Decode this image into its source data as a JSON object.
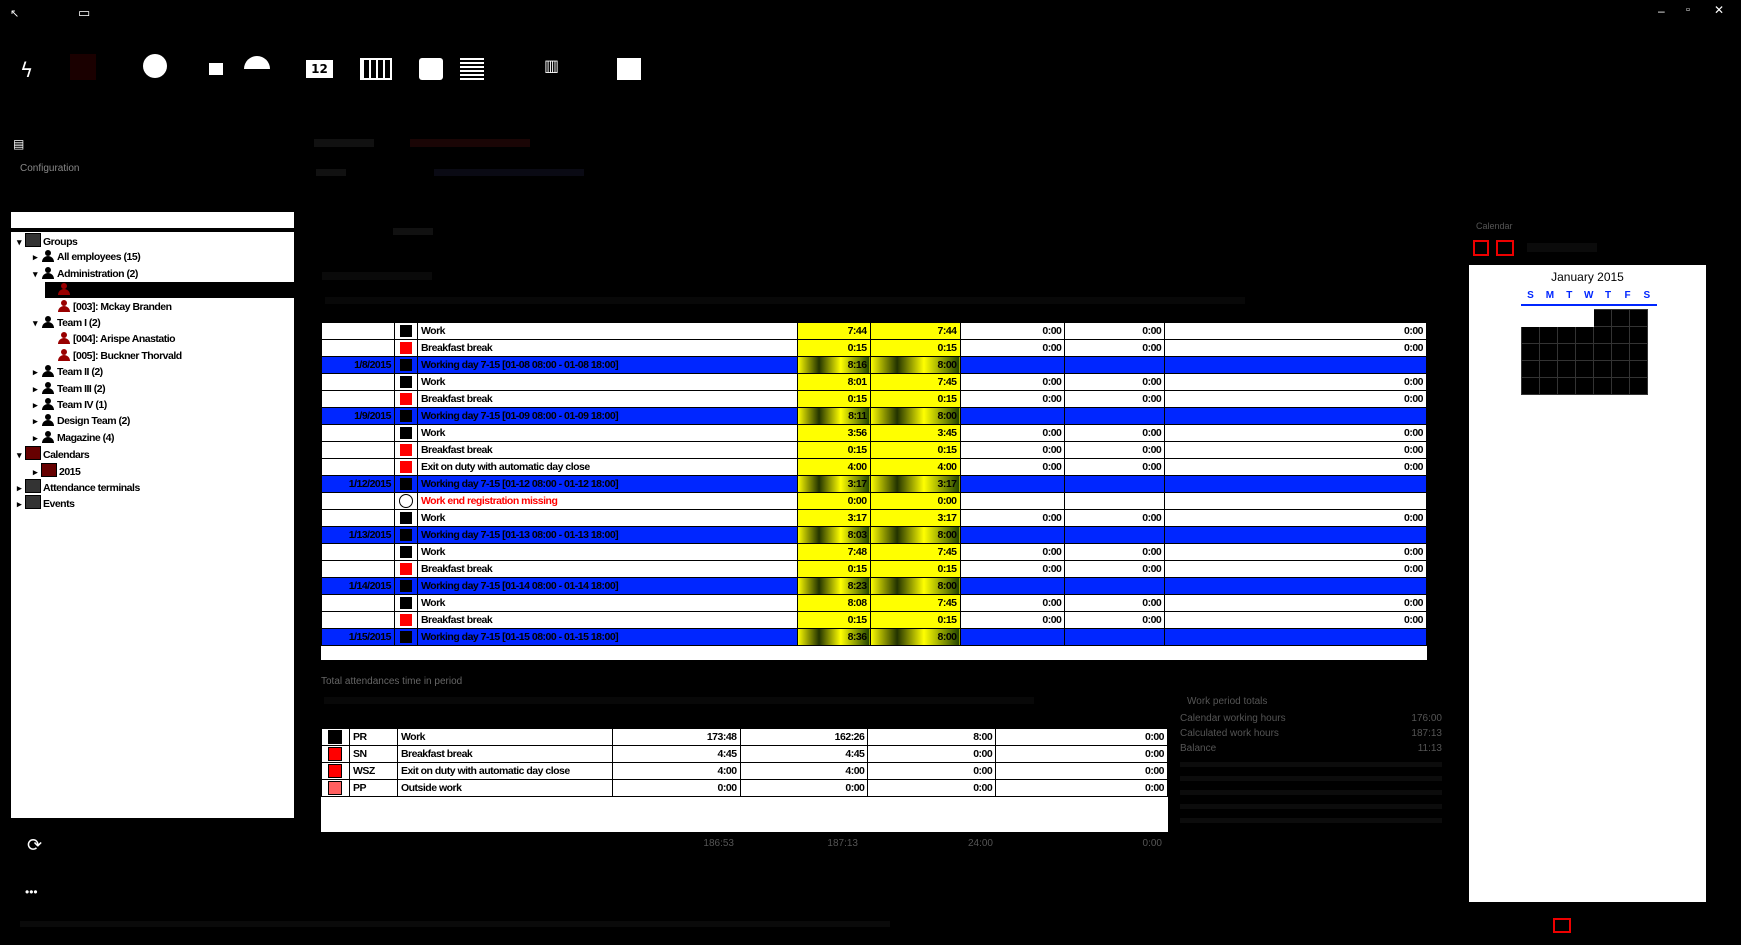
{
  "toolbar": {
    "icons": [
      "flash-icon",
      "clock-icon",
      "calendar-day-icon",
      "gauge-icon",
      "calendar-12-icon",
      "grid-icon",
      "gear-icon",
      "list-icon",
      "building-icon",
      "sliders-icon"
    ]
  },
  "left": {
    "config_label": "Configuration"
  },
  "tree": {
    "items": [
      {
        "arrow": "▾",
        "label": "Groups",
        "indent": 0,
        "icon": "group"
      },
      {
        "arrow": "▸",
        "label": "All employees (15)",
        "indent": 1,
        "icon": "person"
      },
      {
        "arrow": "▾",
        "label": "Administration (2)",
        "indent": 1,
        "icon": "person"
      },
      {
        "arrow": "",
        "label": "",
        "indent": 2,
        "icon": "person-red",
        "selected": true
      },
      {
        "arrow": "",
        "label": "[003]: Mckay Branden",
        "indent": 2,
        "icon": "person-red"
      },
      {
        "arrow": "▾",
        "label": "Team I (2)",
        "indent": 1,
        "icon": "person"
      },
      {
        "arrow": "",
        "label": "[004]: Arispe Anastatio",
        "indent": 2,
        "icon": "person-red"
      },
      {
        "arrow": "",
        "label": "[005]: Buckner Thorvald",
        "indent": 2,
        "icon": "person-red"
      },
      {
        "arrow": "▸",
        "label": "Team II (2)",
        "indent": 1,
        "icon": "person"
      },
      {
        "arrow": "▸",
        "label": "Team III (2)",
        "indent": 1,
        "icon": "person"
      },
      {
        "arrow": "▸",
        "label": "Team IV (1)",
        "indent": 1,
        "icon": "person"
      },
      {
        "arrow": "▸",
        "label": "Design Team (2)",
        "indent": 1,
        "icon": "person"
      },
      {
        "arrow": "▸",
        "label": "Magazine (4)",
        "indent": 1,
        "icon": "person"
      },
      {
        "arrow": "▾",
        "label": "Calendars",
        "indent": 0,
        "icon": "calendar"
      },
      {
        "arrow": "▸",
        "label": "2015",
        "indent": 1,
        "icon": "calendar"
      },
      {
        "arrow": "▸",
        "label": "Attendance terminals",
        "indent": 0,
        "icon": "globe"
      },
      {
        "arrow": "▸",
        "label": "Events",
        "indent": 0,
        "icon": "list"
      }
    ]
  },
  "grid": {
    "rows": [
      {
        "type": "entry",
        "date": "",
        "color": "#000000",
        "desc": "Work",
        "a": "7:44",
        "b": "7:44",
        "c": "0:00",
        "d": "0:00",
        "e": "0:00"
      },
      {
        "type": "entry",
        "date": "",
        "color": "#ff0000",
        "desc": "Breakfast break",
        "a": "0:15",
        "b": "0:15",
        "c": "0:00",
        "d": "0:00",
        "e": "0:00"
      },
      {
        "type": "day",
        "date": "1/8/2015",
        "color": "#000000",
        "desc": "Working day 7-15 [01-08 08:00 - 01-08 18:00]",
        "a": "8:16",
        "b": "8:00",
        "c": "",
        "d": "",
        "e": ""
      },
      {
        "type": "entry",
        "date": "",
        "color": "#000000",
        "desc": "Work",
        "a": "8:01",
        "b": "7:45",
        "c": "0:00",
        "d": "0:00",
        "e": "0:00"
      },
      {
        "type": "entry",
        "date": "",
        "color": "#ff0000",
        "desc": "Breakfast break",
        "a": "0:15",
        "b": "0:15",
        "c": "0:00",
        "d": "0:00",
        "e": "0:00"
      },
      {
        "type": "day",
        "date": "1/9/2015",
        "color": "#000000",
        "desc": "Working day 7-15 [01-09 08:00 - 01-09 18:00]",
        "a": "8:11",
        "b": "8:00",
        "c": "",
        "d": "",
        "e": ""
      },
      {
        "type": "entry",
        "date": "",
        "color": "#000000",
        "desc": "Work",
        "a": "3:56",
        "b": "3:45",
        "c": "0:00",
        "d": "0:00",
        "e": "0:00"
      },
      {
        "type": "entry",
        "date": "",
        "color": "#ff0000",
        "desc": "Breakfast break",
        "a": "0:15",
        "b": "0:15",
        "c": "0:00",
        "d": "0:00",
        "e": "0:00"
      },
      {
        "type": "entry",
        "date": "",
        "color": "#ff0000",
        "desc": "Exit on duty with automatic day close",
        "a": "4:00",
        "b": "4:00",
        "c": "0:00",
        "d": "0:00",
        "e": "0:00"
      },
      {
        "type": "day",
        "date": "1/12/2015",
        "color": "#000000",
        "desc": "Working day 7-15 [01-12 08:00 - 01-12 18:00]",
        "a": "3:17",
        "b": "3:17",
        "c": "",
        "d": "",
        "e": ""
      },
      {
        "type": "warn",
        "date": "",
        "color": "#ffffff",
        "desc": "Work end registration missing",
        "a": "0:00",
        "b": "0:00",
        "c": "",
        "d": "",
        "e": ""
      },
      {
        "type": "entry",
        "date": "",
        "color": "#000000",
        "desc": "Work",
        "a": "3:17",
        "b": "3:17",
        "c": "0:00",
        "d": "0:00",
        "e": "0:00"
      },
      {
        "type": "day",
        "date": "1/13/2015",
        "color": "#000000",
        "desc": "Working day 7-15 [01-13 08:00 - 01-13 18:00]",
        "a": "8:03",
        "b": "8:00",
        "c": "",
        "d": "",
        "e": ""
      },
      {
        "type": "entry",
        "date": "",
        "color": "#000000",
        "desc": "Work",
        "a": "7:48",
        "b": "7:45",
        "c": "0:00",
        "d": "0:00",
        "e": "0:00"
      },
      {
        "type": "entry",
        "date": "",
        "color": "#ff0000",
        "desc": "Breakfast break",
        "a": "0:15",
        "b": "0:15",
        "c": "0:00",
        "d": "0:00",
        "e": "0:00"
      },
      {
        "type": "day",
        "date": "1/14/2015",
        "color": "#000000",
        "desc": "Working day 7-15 [01-14 08:00 - 01-14 18:00]",
        "a": "8:23",
        "b": "8:00",
        "c": "",
        "d": "",
        "e": ""
      },
      {
        "type": "entry",
        "date": "",
        "color": "#000000",
        "desc": "Work",
        "a": "8:08",
        "b": "7:45",
        "c": "0:00",
        "d": "0:00",
        "e": "0:00"
      },
      {
        "type": "entry",
        "date": "",
        "color": "#ff0000",
        "desc": "Breakfast break",
        "a": "0:15",
        "b": "0:15",
        "c": "0:00",
        "d": "0:00",
        "e": "0:00"
      },
      {
        "type": "day",
        "date": "1/15/2015",
        "color": "#000000",
        "desc": "Working day 7-15 [01-15 08:00 - 01-15 18:00]",
        "a": "8:36",
        "b": "8:00",
        "c": "",
        "d": "",
        "e": ""
      }
    ]
  },
  "totals": {
    "title": "Total attendances time in period",
    "rows": [
      {
        "color": "#000000",
        "code": "PR",
        "name": "Work",
        "a": "173:48",
        "b": "162:26",
        "c": "8:00",
        "d": "0:00"
      },
      {
        "color": "#ff0000",
        "code": "SN",
        "name": "Breakfast break",
        "a": "4:45",
        "b": "4:45",
        "c": "0:00",
        "d": "0:00"
      },
      {
        "color": "#ff0000",
        "code": "WSZ",
        "name": "Exit on duty with automatic day close",
        "a": "4:00",
        "b": "4:00",
        "c": "0:00",
        "d": "0:00"
      },
      {
        "color": "#ff6060",
        "code": "PP",
        "name": "Outside work",
        "a": "0:00",
        "b": "0:00",
        "c": "0:00",
        "d": "0:00"
      }
    ],
    "sums": [
      "186:53",
      "187:13",
      "24:00",
      "0:00"
    ]
  },
  "period": {
    "title": "Work period totals",
    "rows": [
      {
        "label": "Calendar working hours",
        "value": "176:00"
      },
      {
        "label": "Calculated work hours",
        "value": "187:13"
      },
      {
        "label": "Balance",
        "value": "11:13"
      }
    ]
  },
  "calendar": {
    "label": "Calendar",
    "month": "January 2015",
    "weekdays": [
      "S",
      "M",
      "T",
      "W",
      "T",
      "F",
      "S"
    ]
  },
  "colors": {
    "accent_blue": "#0026ff",
    "highlight_yellow": "#ffff00",
    "alert_red": "#ff0000"
  }
}
